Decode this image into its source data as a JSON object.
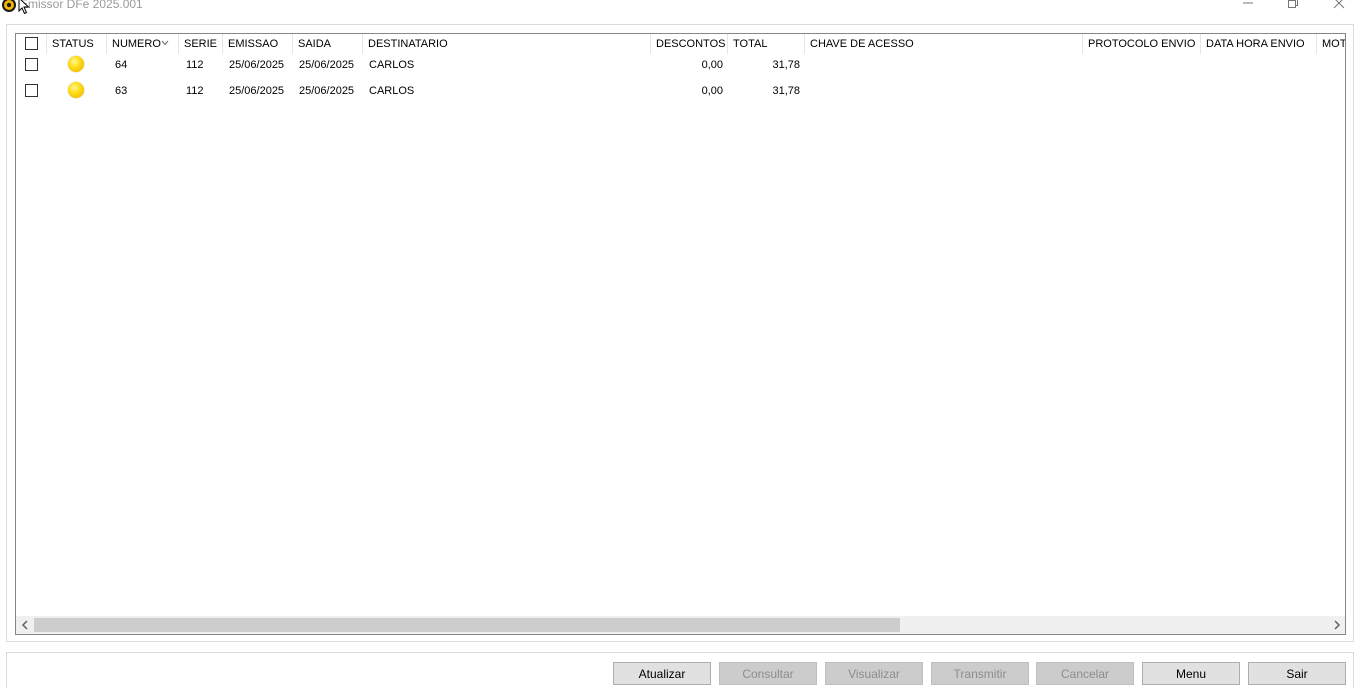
{
  "window": {
    "title": "Emissor DFe 2025.001"
  },
  "grid": {
    "columns": [
      {
        "key": "select",
        "label": ""
      },
      {
        "key": "status",
        "label": "STATUS"
      },
      {
        "key": "numero",
        "label": "NUMERO",
        "sorted": "desc"
      },
      {
        "key": "serie",
        "label": "SERIE"
      },
      {
        "key": "emissao",
        "label": "EMISSAO"
      },
      {
        "key": "saida",
        "label": "SAIDA"
      },
      {
        "key": "destinatario",
        "label": "DESTINATARIO"
      },
      {
        "key": "descontos",
        "label": "DESCONTOS"
      },
      {
        "key": "total",
        "label": "TOTAL"
      },
      {
        "key": "chave",
        "label": "CHAVE DE ACESSO"
      },
      {
        "key": "protocolo",
        "label": "PROTOCOLO ENVIO"
      },
      {
        "key": "datahora",
        "label": "DATA HORA ENVIO"
      },
      {
        "key": "motivo",
        "label": "MOT"
      }
    ],
    "rows": [
      {
        "checked": false,
        "status_color": "#ffd700",
        "numero": "64",
        "serie": "112",
        "emissao": "25/06/2025",
        "saida": "25/06/2025",
        "destinatario": "CARLOS",
        "descontos": "0,00",
        "total": "31,78",
        "chave": "",
        "protocolo": "",
        "datahora": "",
        "motivo": ""
      },
      {
        "checked": false,
        "status_color": "#ffd700",
        "numero": "63",
        "serie": "112",
        "emissao": "25/06/2025",
        "saida": "25/06/2025",
        "destinatario": "CARLOS",
        "descontos": "0,00",
        "total": "31,78",
        "chave": "",
        "protocolo": "",
        "datahora": "",
        "motivo": ""
      }
    ]
  },
  "buttons": {
    "atualizar": {
      "label": "Atualizar",
      "enabled": true
    },
    "consultar": {
      "label": "Consultar",
      "enabled": false
    },
    "visualizar": {
      "label": "Visualizar",
      "enabled": false
    },
    "transmitir": {
      "label": "Transmitir",
      "enabled": false
    },
    "cancelar": {
      "label": "Cancelar",
      "enabled": false
    },
    "menu": {
      "label": "Menu",
      "enabled": true
    },
    "sair": {
      "label": "Sair",
      "enabled": true
    }
  },
  "colors": {
    "status_pending": "#ffd700",
    "border": "#828790",
    "button_bg": "#e1e1e1"
  },
  "icons": {
    "app": "app-logo-icon",
    "minimize": "minimize-icon",
    "maximize": "restore-icon",
    "close": "close-icon",
    "sort": "chevron-down-icon",
    "status": "status-yellow-icon"
  }
}
